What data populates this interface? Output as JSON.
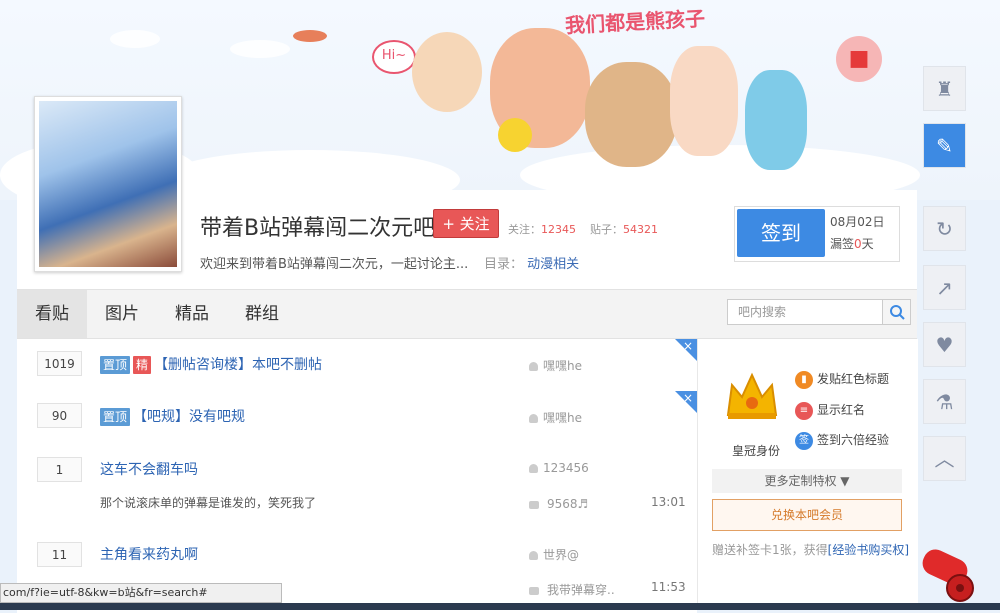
{
  "banner": {
    "slogan": "我们都是熊孩子",
    "bubble": "Hi~"
  },
  "forum": {
    "name": "带着B站弹幕闯二次元吧",
    "follow_label": "+ 关注",
    "followers_label": "关注：",
    "followers": "12345",
    "posts_label": "贴子：",
    "posts": "54321",
    "description": "欢迎来到带着B站弹幕闯二次元，一起讨论主...",
    "catalog_label": "目录：",
    "catalog": "动漫相关"
  },
  "signin": {
    "button": "签到",
    "date": "08月02日",
    "missed_prefix": "漏签",
    "missed_days": "0",
    "missed_suffix": "天"
  },
  "tabs": [
    {
      "label": "看贴",
      "active": true
    },
    {
      "label": "图片",
      "active": false
    },
    {
      "label": "精品",
      "active": false
    },
    {
      "label": "群组",
      "active": false
    }
  ],
  "search": {
    "placeholder": "吧内搜索"
  },
  "threads": [
    {
      "count": "1019",
      "badges": [
        "置顶",
        "精"
      ],
      "title": "【删帖咨询楼】本吧不删帖",
      "author": "嘿嘿he"
    },
    {
      "count": "90",
      "badges": [
        "置顶"
      ],
      "title": "【吧规】没有吧规",
      "author": "嘿嘿he"
    },
    {
      "count": "1",
      "badges": [],
      "title": "这车不会翻车吗",
      "author": "123456",
      "excerpt": "那个说滚床单的弹幕是谁发的，笑死我了",
      "last_reply": "9568♬",
      "time": "13:01"
    },
    {
      "count": "11",
      "badges": [],
      "title": "主角看来药丸啊",
      "author": "世界@",
      "last_reply": "我带弹幕穿..",
      "time": "11:53"
    }
  ],
  "privilege": {
    "crown_label": "皇冠身份",
    "items": [
      "发贴红色标题",
      "显示红名",
      "签到六倍经验"
    ],
    "more": "更多定制特权 ▼",
    "exchange": "兑换本吧会员",
    "gift_prefix": "赠送补签卡1张，获得",
    "gift_link": "[经验书购买权]"
  },
  "status_bar": "com/f?ie=utf-8&kw=b站&fr=search#",
  "colors": {
    "accent_blue": "#3d8ae3",
    "follow_red": "#e85757",
    "link_blue": "#2d64b3"
  }
}
